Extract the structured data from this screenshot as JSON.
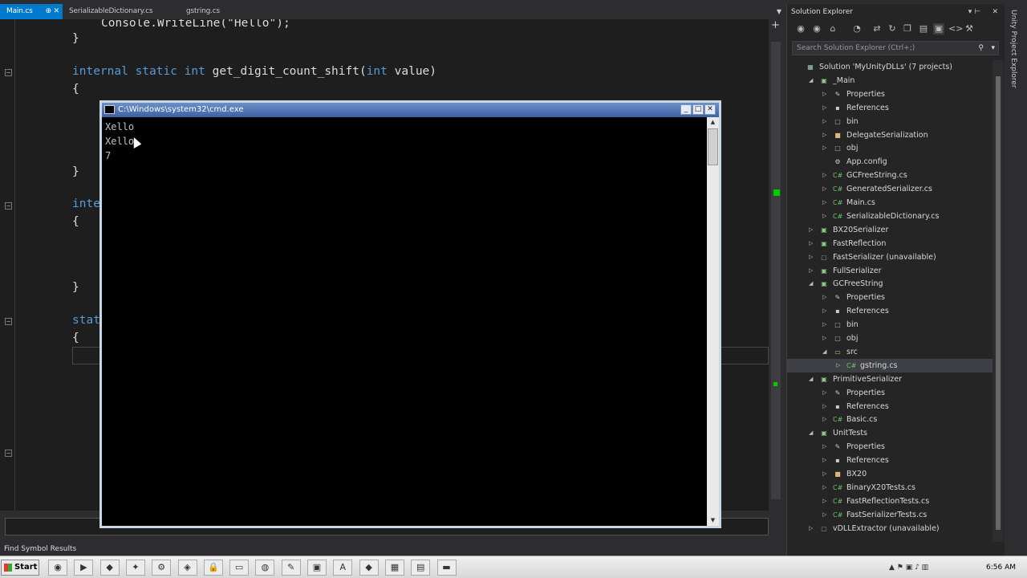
{
  "tabs": [
    {
      "label": "Main.cs",
      "active": true
    },
    {
      "label": "SerializableDictionary.cs",
      "active": false
    },
    {
      "label": "gstring.cs",
      "active": false
    }
  ],
  "editor": {
    "lines": {
      "l1": "Console.WriteLine(\"Hello\");",
      "l2": "}",
      "l3_kw1": "internal",
      "l3_kw2": "static",
      "l3_kw3": "int",
      "l3_fn": "get_digit_count_shift(",
      "l3_kw4": "int",
      "l3_rest": "value)",
      "l4": "{",
      "l5": "}",
      "l6": "inte",
      "l7": "{",
      "l8": "}",
      "l9": "stat",
      "l10": "{"
    }
  },
  "status_bottom": "Find Symbol Results",
  "solution_explorer": {
    "title": "Solution Explorer",
    "search_placeholder": "Search Solution Explorer (Ctrl+;)",
    "side_rail": "Unity Project Explorer",
    "tree": [
      {
        "label": "Solution 'MyUnityDLLs' (7 projects)",
        "level": 0,
        "arrow": "",
        "icon": "solution-icon"
      },
      {
        "label": "_Main",
        "level": 1,
        "arrow": "◢",
        "icon": "project-icon"
      },
      {
        "label": "Properties",
        "level": 2,
        "arrow": "▷",
        "icon": "wrench-icon"
      },
      {
        "label": "References",
        "level": 2,
        "arrow": "▷",
        "icon": "references-icon"
      },
      {
        "label": "bin",
        "level": 2,
        "arrow": "▷",
        "icon": "folder-outline-icon"
      },
      {
        "label": "DelegateSerialization",
        "level": 2,
        "arrow": "▷",
        "icon": "folder-icon"
      },
      {
        "label": "obj",
        "level": 2,
        "arrow": "▷",
        "icon": "folder-outline-icon"
      },
      {
        "label": "App.config",
        "level": 2,
        "arrow": "",
        "icon": "config-icon"
      },
      {
        "label": "GCFreeString.cs",
        "level": 2,
        "arrow": "▷",
        "icon": "csharp-icon"
      },
      {
        "label": "GeneratedSerializer.cs",
        "level": 2,
        "arrow": "▷",
        "icon": "csharp-icon"
      },
      {
        "label": "Main.cs",
        "level": 2,
        "arrow": "▷",
        "icon": "csharp-icon"
      },
      {
        "label": "SerializableDictionary.cs",
        "level": 2,
        "arrow": "▷",
        "icon": "csharp-icon"
      },
      {
        "label": "BX20Serializer",
        "level": 1,
        "arrow": "▷",
        "icon": "project-icon"
      },
      {
        "label": "FastReflection",
        "level": 1,
        "arrow": "▷",
        "icon": "project-icon"
      },
      {
        "label": "FastSerializer (unavailable)",
        "level": 1,
        "arrow": "▷",
        "icon": "project-unavailable-icon"
      },
      {
        "label": "FullSerializer",
        "level": 1,
        "arrow": "▷",
        "icon": "project-icon"
      },
      {
        "label": "GCFreeString",
        "level": 1,
        "arrow": "◢",
        "icon": "project-icon"
      },
      {
        "label": "Properties",
        "level": 2,
        "arrow": "▷",
        "icon": "wrench-icon"
      },
      {
        "label": "References",
        "level": 2,
        "arrow": "▷",
        "icon": "references-icon"
      },
      {
        "label": "bin",
        "level": 2,
        "arrow": "▷",
        "icon": "folder-outline-icon"
      },
      {
        "label": "obj",
        "level": 2,
        "arrow": "▷",
        "icon": "folder-outline-icon"
      },
      {
        "label": "src",
        "level": 2,
        "arrow": "◢",
        "icon": "folder-open-icon"
      },
      {
        "label": "gstring.cs",
        "level": 3,
        "arrow": "▷",
        "icon": "csharp-icon",
        "selected": true
      },
      {
        "label": "PrimitiveSerializer",
        "level": 1,
        "arrow": "◢",
        "icon": "project-icon"
      },
      {
        "label": "Properties",
        "level": 2,
        "arrow": "▷",
        "icon": "wrench-icon"
      },
      {
        "label": "References",
        "level": 2,
        "arrow": "▷",
        "icon": "references-icon"
      },
      {
        "label": "Basic.cs",
        "level": 2,
        "arrow": "▷",
        "icon": "csharp-icon"
      },
      {
        "label": "UnitTests",
        "level": 1,
        "arrow": "◢",
        "icon": "test-project-icon"
      },
      {
        "label": "Properties",
        "level": 2,
        "arrow": "▷",
        "icon": "wrench-icon"
      },
      {
        "label": "References",
        "level": 2,
        "arrow": "▷",
        "icon": "references-icon"
      },
      {
        "label": "BX20",
        "level": 2,
        "arrow": "▷",
        "icon": "folder-icon"
      },
      {
        "label": "BinaryX20Tests.cs",
        "level": 2,
        "arrow": "▷",
        "icon": "csharp-icon"
      },
      {
        "label": "FastReflectionTests.cs",
        "level": 2,
        "arrow": "▷",
        "icon": "csharp-icon"
      },
      {
        "label": "FastSerializerTests.cs",
        "level": 2,
        "arrow": "▷",
        "icon": "csharp-icon"
      },
      {
        "label": "vDLLExtractor (unavailable)",
        "level": 1,
        "arrow": "▷",
        "icon": "project-unavailable-icon"
      }
    ]
  },
  "cmd": {
    "title": "C:\\Windows\\system32\\cmd.exe",
    "output": [
      "Xello",
      "Xello",
      "7"
    ]
  },
  "taskbar": {
    "start_label": "Start",
    "clock": "6:56 AM",
    "apps": [
      "firefox-icon",
      "vs-icon",
      "vs-purple-icon",
      "utility-icon",
      "tools-icon",
      "unity-icon",
      "lock-icon",
      "folder-icon",
      "chat-icon",
      "notes-icon",
      "terminal-icon",
      "acrobat-icon",
      "git-icon",
      "calc-icon",
      "explorer-icon",
      "cmd-icon"
    ]
  },
  "colors": {
    "accent": "#007acc",
    "editor_bg": "#1e1e1e",
    "keyword": "#569cd6",
    "string": "#d69d85"
  }
}
